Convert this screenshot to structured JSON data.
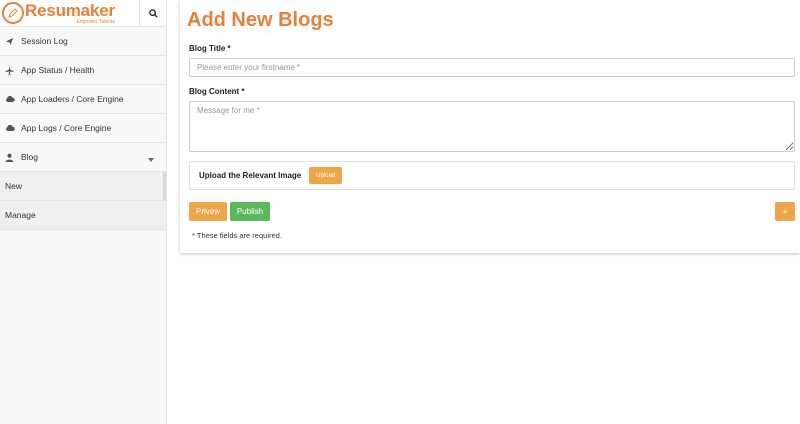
{
  "brand": {
    "name": "Resumaker",
    "tagline": "Empower Talents",
    "accent_color": "#e8803a"
  },
  "sidebar": {
    "items": [
      {
        "label": "Session Log",
        "icon": "paper-plane-icon"
      },
      {
        "label": "App Status / Health",
        "icon": "plane-icon"
      },
      {
        "label": "App Loaders / Core Engine",
        "icon": "cloud-icon"
      },
      {
        "label": "App Logs / Core Engine",
        "icon": "cloud-icon"
      },
      {
        "label": "Blog",
        "icon": "user-icon",
        "expanded": true
      }
    ],
    "sub_items": [
      {
        "label": "New",
        "active": true
      },
      {
        "label": "Manage",
        "active": false
      }
    ]
  },
  "page": {
    "title": "Add New Blogs"
  },
  "form": {
    "blog_title_label": "Blog Title *",
    "blog_title_placeholder": "Please enter your firstname *",
    "blog_title_value": "",
    "blog_content_label": "Blog Content *",
    "blog_content_placeholder": "Message for me *",
    "blog_content_value": "",
    "upload_label": "Upload the Relevant Image",
    "upload_button": "Upload",
    "preview_button": "Privew",
    "publish_button": "Publish",
    "add_button": "+",
    "required_note": "* These fields are required."
  }
}
